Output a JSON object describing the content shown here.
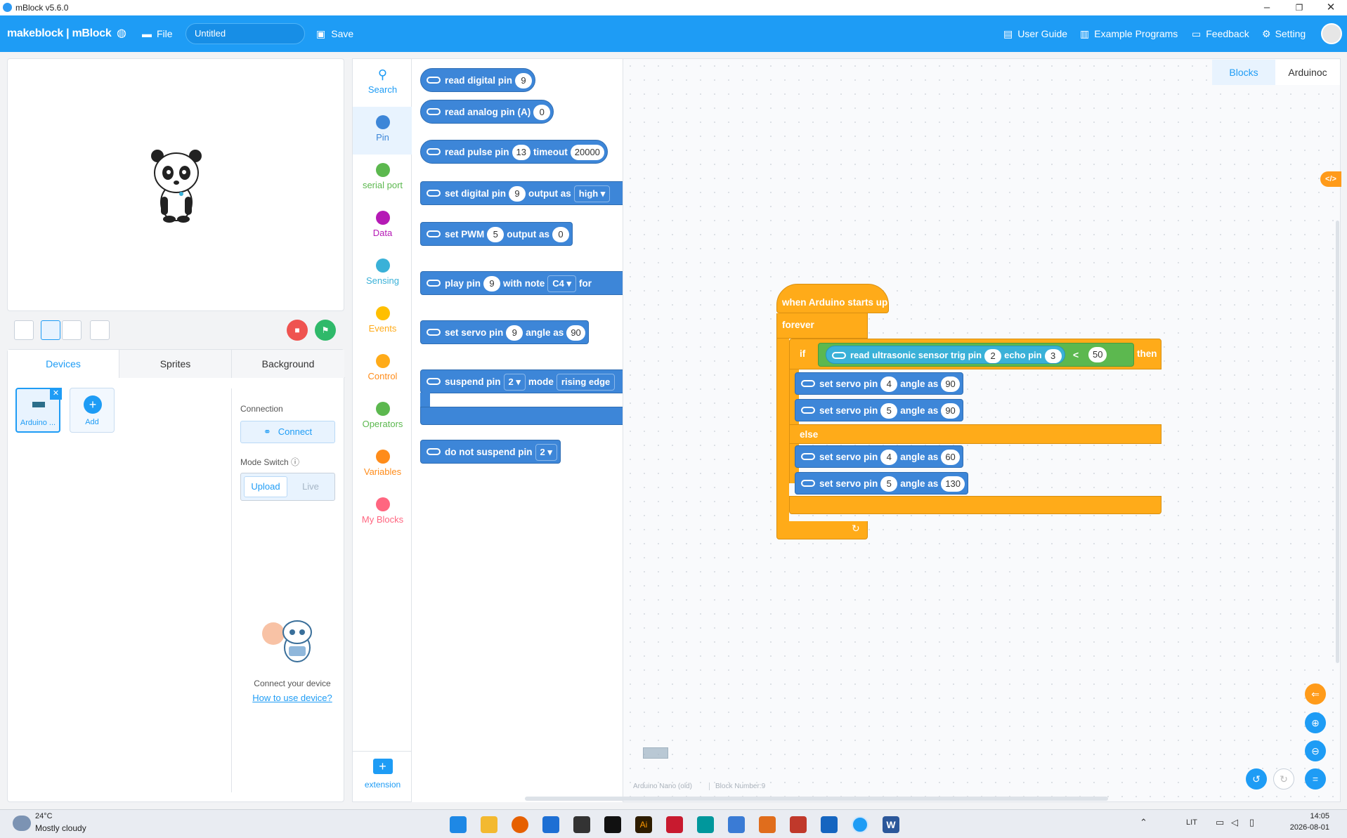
{
  "window": {
    "title": "mBlock v5.6.0"
  },
  "menubar": {
    "logo": "makeblock | mBlock",
    "file": "File",
    "project_title": "Untitled",
    "save": "Save",
    "user_guide": "User Guide",
    "example_programs": "Example Programs",
    "feedback": "Feedback",
    "setting": "Setting"
  },
  "device_panel": {
    "tabs": [
      "Devices",
      "Sprites",
      "Background"
    ],
    "device_name": "Arduino ...",
    "add": "Add",
    "connection_label": "Connection",
    "connect": "Connect",
    "mode_switch_label": "Mode Switch",
    "mode_upload": "Upload",
    "mode_live": "Live",
    "connect_hint": "Connect your device",
    "how_to_link": "How to use device?"
  },
  "categories": [
    {
      "label": "Search",
      "color": "#1e9cf5"
    },
    {
      "label": "Pin",
      "color": "#3d86d8"
    },
    {
      "label": "serial port",
      "color": "#5cb84f"
    },
    {
      "label": "Data",
      "color": "#b51ab5"
    },
    {
      "label": "Sensing",
      "color": "#3ab1d8"
    },
    {
      "label": "Events",
      "color": "#ffbf00"
    },
    {
      "label": "Control",
      "color": "#ffab19"
    },
    {
      "label": "Operators",
      "color": "#5cb84f"
    },
    {
      "label": "Variables",
      "color": "#ff8c1a"
    },
    {
      "label": "My Blocks",
      "color": "#ff6680"
    }
  ],
  "extension_label": "extension",
  "palette": {
    "read_digital": {
      "label": "read digital pin",
      "v": "9"
    },
    "read_analog": {
      "label": "read analog pin (A)",
      "v": "0"
    },
    "read_pulse": {
      "label": "read pulse pin",
      "v": "13",
      "label2": "timeout",
      "v2": "20000"
    },
    "set_digital": {
      "label": "set digital pin",
      "v": "9",
      "label2": "output as",
      "v2": "high ▾"
    },
    "set_pwm": {
      "label": "set PWM",
      "v": "5",
      "label2": "output as",
      "v2": "0"
    },
    "play_pin": {
      "label": "play pin",
      "v": "9",
      "label2": "with note",
      "v2": "C4 ▾",
      "label3": "for"
    },
    "set_servo": {
      "label": "set servo pin",
      "v": "9",
      "label2": "angle as",
      "v2": "90"
    },
    "suspend": {
      "label": "suspend pin",
      "v": "2 ▾",
      "label2": "mode",
      "v2": "rising edge"
    },
    "no_suspend": {
      "label": "do not suspend pin",
      "v": "2 ▾"
    }
  },
  "workspace": {
    "tab_blocks": "Blocks",
    "tab_code": "Arduinoc",
    "hat": "when Arduino starts up",
    "forever": "forever",
    "if": "if",
    "then": "then",
    "else": "else",
    "sensor": {
      "label": "read ultrasonic sensor trig pin",
      "trig": "2",
      "echo_label": "echo pin",
      "echo": "3",
      "op": "<",
      "cmp": "50"
    },
    "servo_label": "set servo pin",
    "angle_label": "angle as",
    "if_blocks": [
      {
        "pin": "4",
        "angle": "90"
      },
      {
        "pin": "5",
        "angle": "90"
      }
    ],
    "else_blocks": [
      {
        "pin": "4",
        "angle": "60"
      },
      {
        "pin": "5",
        "angle": "130"
      }
    ],
    "footer_device": "Arduino Nano (old)",
    "footer_count": "Block Number:9"
  },
  "taskbar": {
    "weather_temp": "24°C",
    "weather_desc": "Mostly cloudy",
    "lang": "LIT",
    "time": "14:05",
    "date": "2026-08-01"
  }
}
